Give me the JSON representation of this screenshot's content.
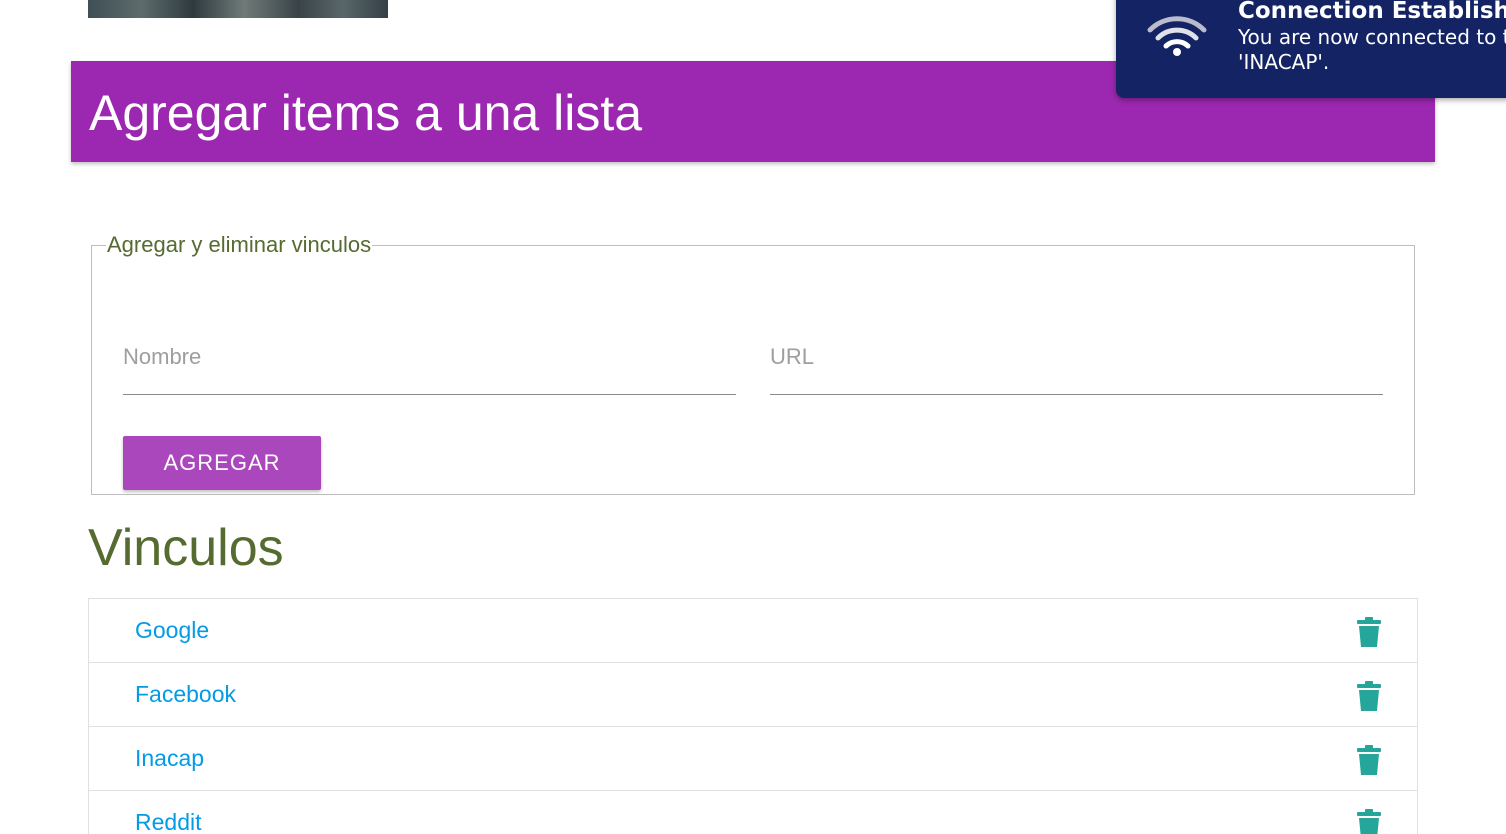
{
  "header": {
    "title": "Agregar items a una lista",
    "color": "#9c27b0"
  },
  "form": {
    "legend": "Agregar y eliminar vinculos",
    "nombre_placeholder": "Nombre",
    "url_placeholder": "URL",
    "nombre_value": "",
    "url_value": "",
    "add_label": "AGREGAR"
  },
  "links_section": {
    "title": "Vinculos",
    "items": [
      {
        "label": "Google",
        "delete_icon": "trash-icon"
      },
      {
        "label": "Facebook",
        "delete_icon": "trash-icon"
      },
      {
        "label": "Inacap",
        "delete_icon": "trash-icon"
      },
      {
        "label": "Reddit",
        "delete_icon": "trash-icon"
      }
    ],
    "link_color": "#039be5",
    "icon_color": "#26a69a"
  },
  "notification": {
    "title": "Connection Established",
    "message": "You are now connected to the network\n'INACAP'.",
    "icon": "wifi-icon"
  }
}
